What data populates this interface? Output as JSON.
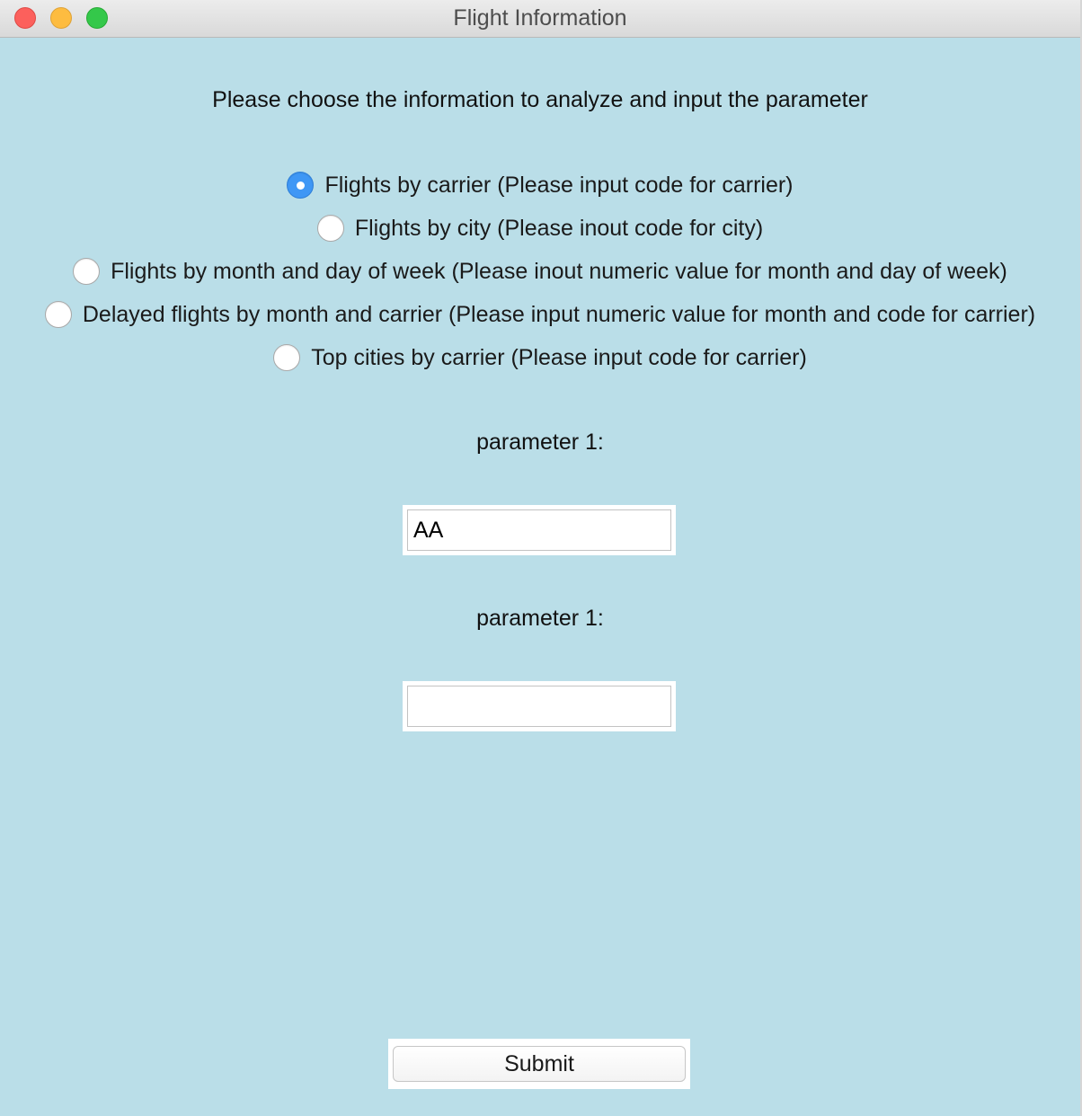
{
  "window": {
    "title": "Flight Information"
  },
  "instruction": "Please choose the information to analyze and input the parameter",
  "options": [
    {
      "label": "Flights by carrier (Please input code for carrier)",
      "checked": true
    },
    {
      "label": "Flights by city (Please inout code for city)",
      "checked": false
    },
    {
      "label": "Flights by month and day of week (Please inout numeric value for month and day of week)",
      "checked": false
    },
    {
      "label": "Delayed flights by month and carrier (Please input numeric value for month and code for carrier)",
      "checked": false
    },
    {
      "label": "Top cities by carrier (Please input code for carrier)",
      "checked": false
    }
  ],
  "params": [
    {
      "label": "parameter 1:",
      "value": "AA"
    },
    {
      "label": "parameter 1:",
      "value": ""
    }
  ],
  "submit_label": "Submit",
  "colors": {
    "background": "#badee8",
    "radio_selected": "#3f97f5",
    "close": "#fc605c",
    "minimize": "#fdbc40",
    "zoom": "#34c84a"
  }
}
